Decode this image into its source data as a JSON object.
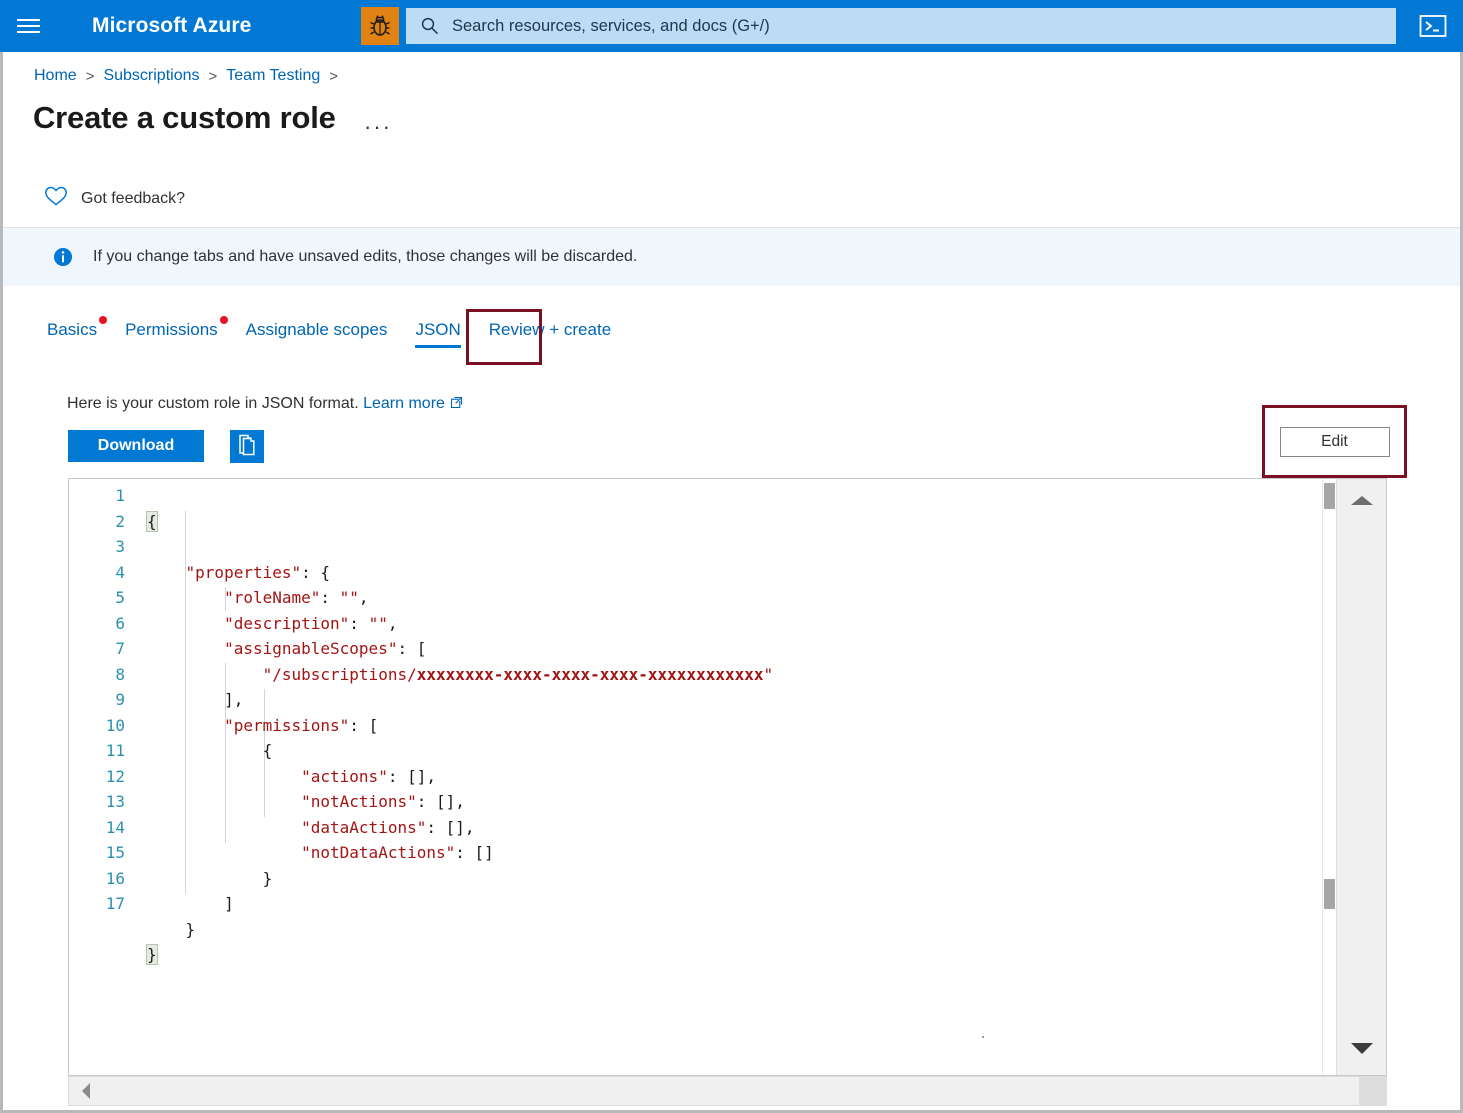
{
  "topbar": {
    "menu_icon": "hamburger-icon",
    "brand": "Microsoft Azure",
    "bug_icon": "bug-icon",
    "search_icon": "search-icon",
    "search_placeholder": "Search resources, services, and docs (G+/)",
    "search_value": "",
    "cloudshell_icon": "cloud-shell-icon",
    "bg_color": "#0078d4",
    "search_bg": "#bcdcf4",
    "bug_bg": "#e08214"
  },
  "breadcrumb": {
    "items": [
      {
        "label": "Home"
      },
      {
        "label": "Subscriptions"
      },
      {
        "label": "Team Testing"
      }
    ],
    "separator": ">",
    "trailing_separator": ">"
  },
  "header": {
    "title": "Create a custom role",
    "more_actions": "···"
  },
  "feedback": {
    "icon": "heart-icon",
    "label": "Got feedback?"
  },
  "infobar": {
    "icon": "info-icon",
    "message": "If you change tabs and have unsaved edits, those changes will be discarded.",
    "bg_color": "#eff6fc"
  },
  "tabs": {
    "items": [
      {
        "label": "Basics",
        "has_dot": true,
        "active": false
      },
      {
        "label": "Permissions",
        "has_dot": true,
        "active": false
      },
      {
        "label": "Assignable scopes",
        "has_dot": false,
        "active": false
      },
      {
        "label": "JSON",
        "has_dot": false,
        "active": true
      },
      {
        "label": "Review + create",
        "has_dot": false,
        "active": false
      }
    ],
    "highlight_color": "#7b1025",
    "active_underline_color": "#0078d4",
    "dot_color": "#e81123"
  },
  "json_panel": {
    "hint_text": "Here is your custom role in JSON format.",
    "learn_more_label": "Learn more",
    "learn_more_icon": "external-link-icon",
    "download_label": "Download",
    "copy_icon": "copy-icon",
    "edit_label": "Edit",
    "edit_highlight_color": "#7b1025"
  },
  "editor": {
    "line_numbers": [
      "1",
      "2",
      "3",
      "4",
      "5",
      "6",
      "7",
      "8",
      "9",
      "10",
      "11",
      "12",
      "13",
      "14",
      "15",
      "16",
      "17"
    ],
    "lines": [
      "{",
      "    \"properties\": {",
      "        \"roleName\": \"\",",
      "        \"description\": \"\",",
      "        \"assignableScopes\": [",
      "            \"/subscriptions/xxxxxxxx-xxxx-xxxx-xxxx-xxxxxxxxxxxx\"",
      "        ],",
      "        \"permissions\": [",
      "            {",
      "                \"actions\": [],",
      "                \"notActions\": [],",
      "                \"dataActions\": [],",
      "                \"notDataActions\": []",
      "            }",
      "        ]",
      "    }",
      "}"
    ],
    "subscription_placeholder": "xxxxxxxx-xxxx-xxxx-xxxx-xxxxxxxxxxxx",
    "string_color": "#a31515",
    "line_number_color": "#2b91af",
    "vscroll_up_icon": "scroll-up-arrow-icon",
    "vscroll_down_icon": "scroll-down-arrow-icon",
    "hscroll_left_icon": "scroll-left-arrow-icon",
    "hscroll_right_icon": "scroll-right-arrow-icon"
  }
}
